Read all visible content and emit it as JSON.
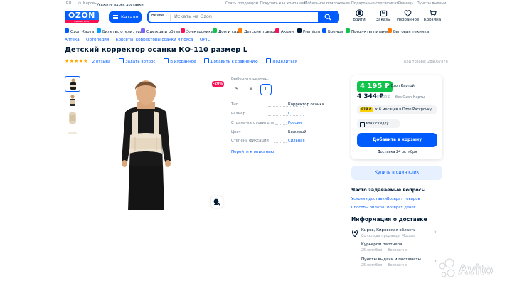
{
  "topbar": {
    "lang": "RU",
    "city": "Киров",
    "address_prompt": "Укажите адрес доставки",
    "links": [
      "Стать продавцом",
      "Покупать как компания",
      "Мобильное приложение",
      "Подарочные сертификаты",
      "Помощь",
      "Пункты выдачи"
    ]
  },
  "header": {
    "logo": "OZON",
    "logo_sub": "ОДОБРЕНО ПОКУПАТЕЛЯМИ",
    "catalog": "Каталог",
    "search_scope": "Везде",
    "search_placeholder": "Искать на Ozon",
    "icons": [
      {
        "label": "Войти",
        "icon": "user-icon"
      },
      {
        "label": "Заказы",
        "icon": "box-icon"
      },
      {
        "label": "Избранное",
        "icon": "heart-icon"
      },
      {
        "label": "Корзина",
        "icon": "cart-icon"
      }
    ]
  },
  "category_nav": [
    {
      "label": "Ozon Карта",
      "color": "#005bff"
    },
    {
      "label": "Билеты, отели, туры",
      "color": "#00a2ff"
    },
    {
      "label": "Одежда и обувь",
      "color": "#7b61ff"
    },
    {
      "label": "Электроника",
      "color": "#f91155"
    },
    {
      "label": "Дом и сад",
      "color": "#10c44c"
    },
    {
      "label": "Детские товары",
      "color": "#ff7a00"
    },
    {
      "label": "Акции",
      "color": "#f91155"
    },
    {
      "label": "Premium",
      "color": "#001a34"
    },
    {
      "label": "Бренды",
      "color": "#005bff"
    },
    {
      "label": "Продукты питания",
      "color": "#10c44c"
    },
    {
      "label": "Бытовая техника",
      "color": "#ff7a00"
    }
  ],
  "breadcrumbs": [
    "Аптека",
    "Ортопедия",
    "Корсеты, корректоры осанки и пояса",
    "ОРТО"
  ],
  "product": {
    "title": "Детский корректор осанки КО-110 размер L",
    "stars": "★★★★★",
    "reviews": "2 отзыва",
    "ask": "Задать вопрос",
    "favorite": "В избранное",
    "compare": "Добавить к сравнению",
    "share": "Поделиться",
    "code": "Код товара: 289057878",
    "discount_badge": "-20%"
  },
  "sizes": {
    "label": "Выберите размер:",
    "options": [
      "S",
      "M",
      "L"
    ],
    "selected": "L"
  },
  "specs": [
    {
      "key": "Тип",
      "value": "Корректор осанки",
      "link": false
    },
    {
      "key": "Размер",
      "value": "L",
      "link": true
    },
    {
      "key": "Страна-изготовитель",
      "value": "Россия",
      "link": true
    },
    {
      "key": "Цвет",
      "value": "Бежевый",
      "link": false
    },
    {
      "key": "Степень фиксации",
      "value": "Сильная",
      "link": true
    }
  ],
  "more_link": "Перейти к описанию",
  "price": {
    "card_price": "4 195 ₽",
    "card_label": "с Ozon Картой",
    "regular_price": "4 344 ₽",
    "old_price": "5 200 ₽",
    "regular_label": "без Ozon Карты",
    "installment_amount": "818 ₽",
    "installment_text": "× 6 месяцев в Ozon Рассрочку",
    "discount_btn": "Хочу скидку",
    "cart_btn": "Добавить в корзину",
    "delivery_date": "Доставка 24 октября",
    "one_click": "Купить в один клик"
  },
  "faq": {
    "title": "Часто задаваемые вопросы",
    "items": [
      "Условия доставки",
      "Возврат товаров",
      "Способы оплаты",
      "Возврат денег"
    ]
  },
  "delivery": {
    "title": "Информация о доставке",
    "address": "Киров, Кировская область",
    "address_sub": "Со склада продавца: Москва",
    "courier": "Курьером партнера",
    "courier_sub": "25 октября — бесплатно",
    "pickup": "Пункты выдачи и постаматы",
    "pickup_sub": "25 октября — бесплатно"
  },
  "watermark": "Avito"
}
